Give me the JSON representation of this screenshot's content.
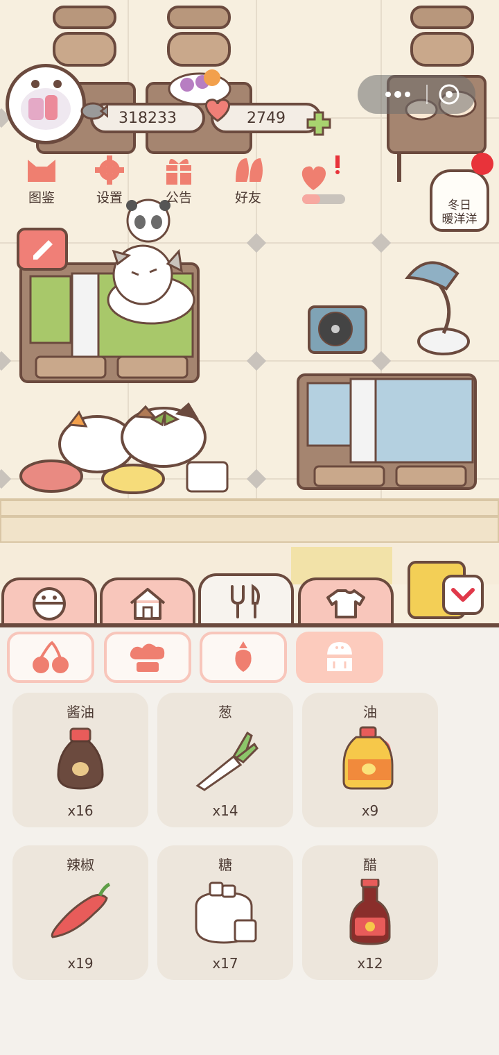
{
  "hud": {
    "coins": "318233",
    "hearts": "2749"
  },
  "menu": [
    {
      "label": "图鉴"
    },
    {
      "label": "设置"
    },
    {
      "label": "公告"
    },
    {
      "label": "好友"
    }
  ],
  "event": {
    "label": "冬日\n暖洋洋"
  },
  "tabs": [
    "face-icon",
    "house-icon",
    "cutlery-icon",
    "shirt-icon"
  ],
  "subcategories": [
    "cherry-icon",
    "cake-icon",
    "carrot-icon",
    "salt-shaker-icon"
  ],
  "items": [
    {
      "name": "酱油",
      "qty": "x16",
      "icon": "soy-sauce-icon"
    },
    {
      "name": "葱",
      "qty": "x14",
      "icon": "scallion-icon"
    },
    {
      "name": "油",
      "qty": "x9",
      "icon": "oil-bottle-icon"
    },
    {
      "name": "辣椒",
      "qty": "x19",
      "icon": "chili-pepper-icon"
    },
    {
      "name": "糖",
      "qty": "x17",
      "icon": "sugar-bag-icon"
    },
    {
      "name": "醋",
      "qty": "x12",
      "icon": "vinegar-bottle-icon"
    }
  ],
  "colors": {
    "outline": "#6b4a3e",
    "tab_pink": "#f8c6bb",
    "card_bg": "#ede6dc",
    "floor": "#f7efdf"
  }
}
